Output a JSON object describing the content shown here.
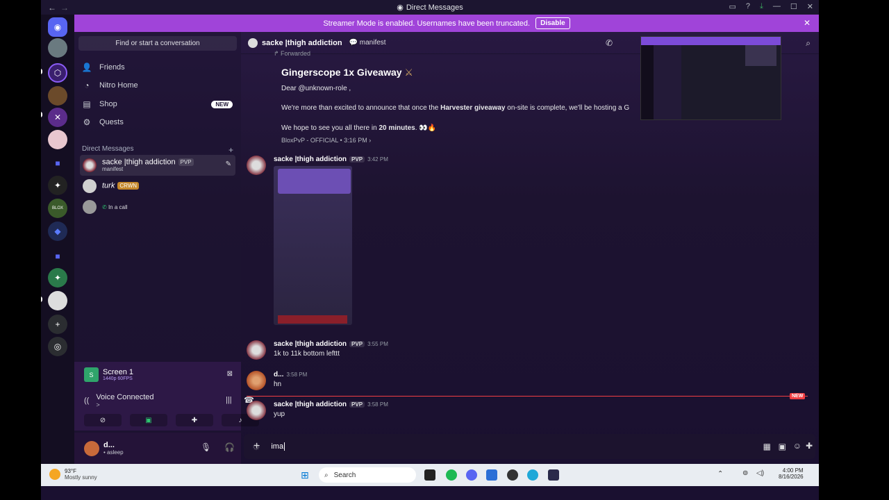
{
  "window": {
    "title": "Direct Messages"
  },
  "banner": {
    "text": "Streamer Mode is enabled. Usernames have been truncated.",
    "button": "Disable"
  },
  "sidebar": {
    "search": "Find or start a conversation",
    "nav": [
      {
        "label": "Friends",
        "icon": "friends-icon"
      },
      {
        "label": "Nitro Home",
        "icon": "nitro-icon"
      },
      {
        "label": "Shop",
        "icon": "shop-icon",
        "badge": "NEW"
      },
      {
        "label": "Quests",
        "icon": "quests-icon"
      }
    ],
    "dm_header": "Direct Messages",
    "dms": [
      {
        "name": "sacke |thigh addiction",
        "tag": "PVP",
        "sub": "manifest"
      },
      {
        "name": "turk",
        "tag": "CRWN",
        "sub": ""
      },
      {
        "name": "",
        "tag": "",
        "sub": "In a call"
      }
    ]
  },
  "voice": {
    "screen_title": "Screen 1",
    "screen_sub": "1440p 60FPS",
    "status": "Voice Connected",
    "arrow": ">"
  },
  "user": {
    "name": "d...",
    "status": "• asleep"
  },
  "channel": {
    "name": "sacke |thigh addiction",
    "status": "manifest"
  },
  "messages": {
    "forward_label": "Forwarded",
    "giveaway_title": "Gingerscope 1x Giveaway",
    "giveaway_dear": "Dear @unknown-role ,",
    "giveaway_line1_a": "We're more than excited to announce that once the ",
    "giveaway_line1_b": "Harvester giveaway",
    "giveaway_line1_c": " on-site is complete, we'll be hosting a G",
    "giveaway_line2_a": "We hope to see you all there in ",
    "giveaway_line2_b": "20 minutes",
    "giveaway_line2_c": ". 👀🔥",
    "giveaway_source": "BloxPvP - OFFICIAL • 3:16 PM ›",
    "list": [
      {
        "author": "sacke |thigh addiction",
        "tag": "PVP",
        "time": "3:42 PM",
        "text": ""
      },
      {
        "author": "sacke |thigh addiction",
        "tag": "PVP",
        "time": "3:55 PM",
        "text": "1k to 11k bottom lefttt"
      },
      {
        "author": "d...",
        "tag": "",
        "time": "3:58 PM",
        "text": "hn"
      },
      {
        "author": "sacke |thigh addiction",
        "tag": "PVP",
        "time": "3:58 PM",
        "text": "yup"
      }
    ],
    "new_label": "NEW"
  },
  "composer": {
    "value": "ima"
  },
  "taskbar": {
    "weather_temp": "93°F",
    "weather_desc": "Mostly sunny",
    "search": "Search",
    "time": "4:00 PM",
    "date": "8/16/2026"
  }
}
